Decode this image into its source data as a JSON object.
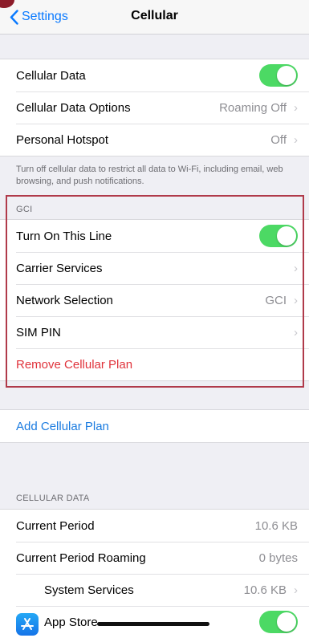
{
  "nav": {
    "back_label": "Settings",
    "title": "Cellular"
  },
  "group1": {
    "cellular_data_label": "Cellular Data",
    "cellular_data_options_label": "Cellular Data Options",
    "cellular_data_options_value": "Roaming Off",
    "personal_hotspot_label": "Personal Hotspot",
    "personal_hotspot_value": "Off"
  },
  "footer_note": "Turn off cellular data to restrict all data to Wi-Fi, including email, web browsing, and push notifications.",
  "gci": {
    "header": "GCI",
    "turn_on_label": "Turn On This Line",
    "carrier_services_label": "Carrier Services",
    "network_selection_label": "Network Selection",
    "network_selection_value": "GCI",
    "sim_pin_label": "SIM PIN",
    "remove_plan_label": "Remove Cellular Plan"
  },
  "add_plan_label": "Add Cellular Plan",
  "cellular_data_section": {
    "header": "CELLULAR DATA",
    "current_period_label": "Current Period",
    "current_period_value": "10.6 KB",
    "roaming_label": "Current Period Roaming",
    "roaming_value": "0 bytes",
    "system_services_label": "System Services",
    "system_services_value": "10.6 KB",
    "app_store_label": "App Store"
  },
  "toggles": {
    "cellular_data": true,
    "turn_on_line": true,
    "app_store": true
  },
  "colors": {
    "accent": "#0a7aff",
    "toggle_on": "#4cd964",
    "danger": "#e0333b",
    "highlight": "#b03a4a"
  }
}
